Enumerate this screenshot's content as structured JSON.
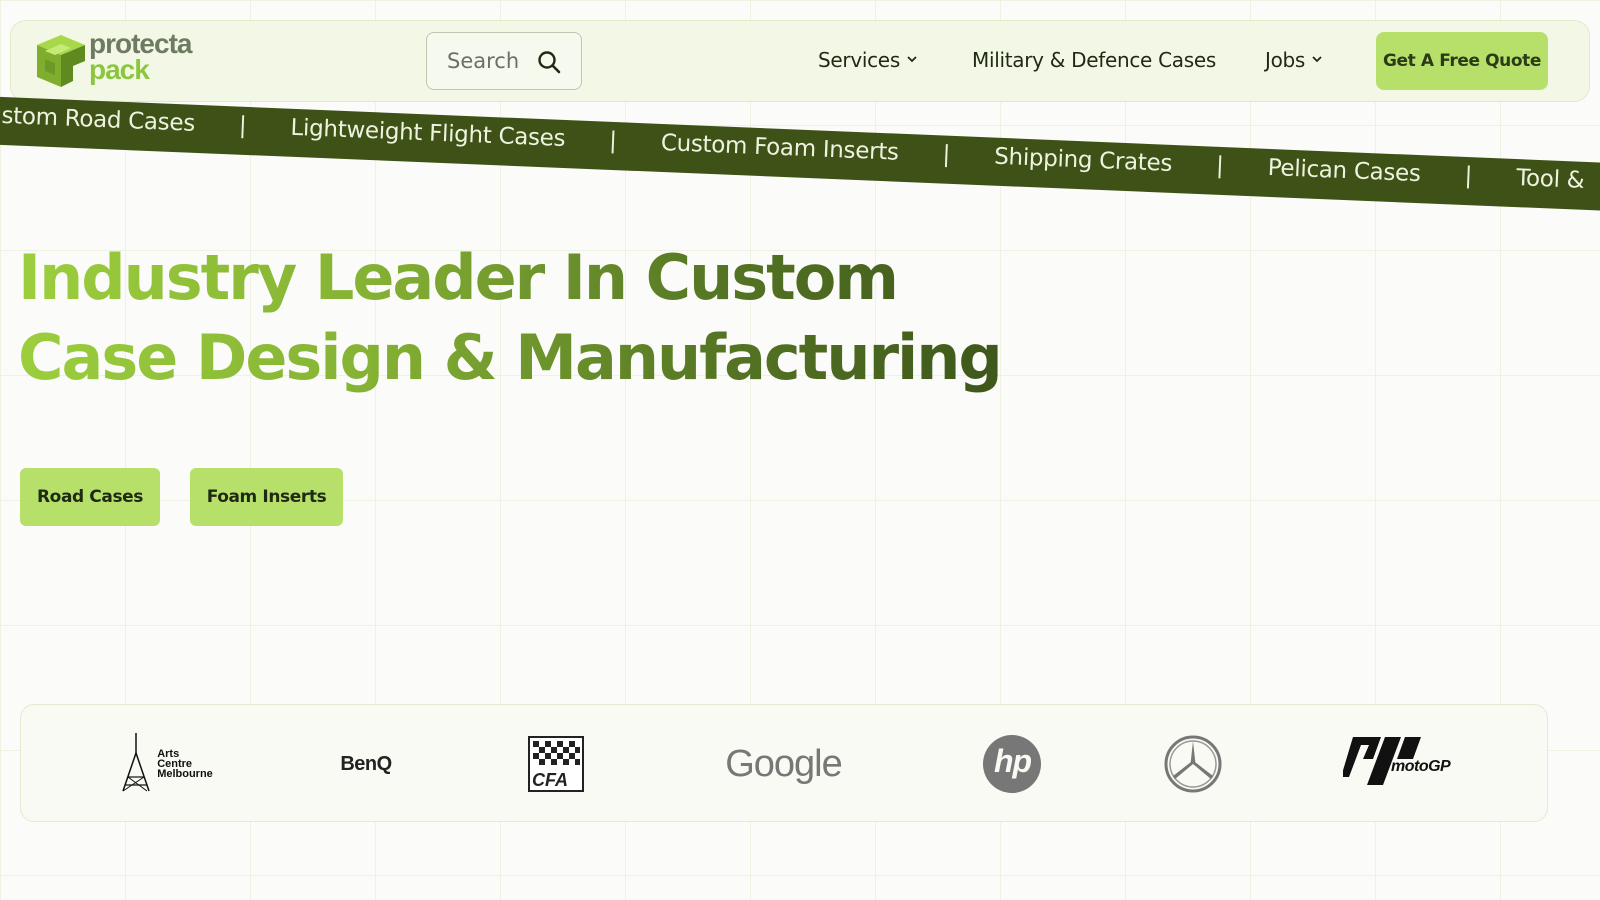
{
  "header": {
    "logo": {
      "line1": "protecta",
      "line2": "pack",
      "icon": "protecta-pack-logo-icon"
    },
    "search": {
      "placeholder": "Search",
      "icon": "search-icon"
    },
    "nav": [
      {
        "label": "Services",
        "has_dropdown": true
      },
      {
        "label": "Military & Defence Cases",
        "has_dropdown": false
      },
      {
        "label": "Jobs",
        "has_dropdown": true
      }
    ],
    "cta_label": "Get A Free Quote"
  },
  "ticker": {
    "items": [
      "ustom Road Cases",
      "Lightweight Flight Cases",
      "Custom Foam Inserts",
      "Shipping Crates",
      "Pelican Cases",
      "Tool &"
    ],
    "separator": "|"
  },
  "hero": {
    "title_line1": "Industry Leader In Custom",
    "title_line2": "Case Design & Manufacturing",
    "buttons": [
      "Road Cases",
      "Foam Inserts"
    ]
  },
  "clients": {
    "arts_centre": [
      "Arts",
      "Centre",
      "Melbourne"
    ],
    "benq": "BenQ",
    "cfa": "CFA",
    "google": "Google",
    "hp": "hp",
    "mercedes_icon": "mercedes-benz-logo",
    "motogp": "motoGP"
  },
  "colors": {
    "accent": "#b7e06b",
    "brand_dark": "#3e5217",
    "brand_green": "#8cc63f"
  }
}
